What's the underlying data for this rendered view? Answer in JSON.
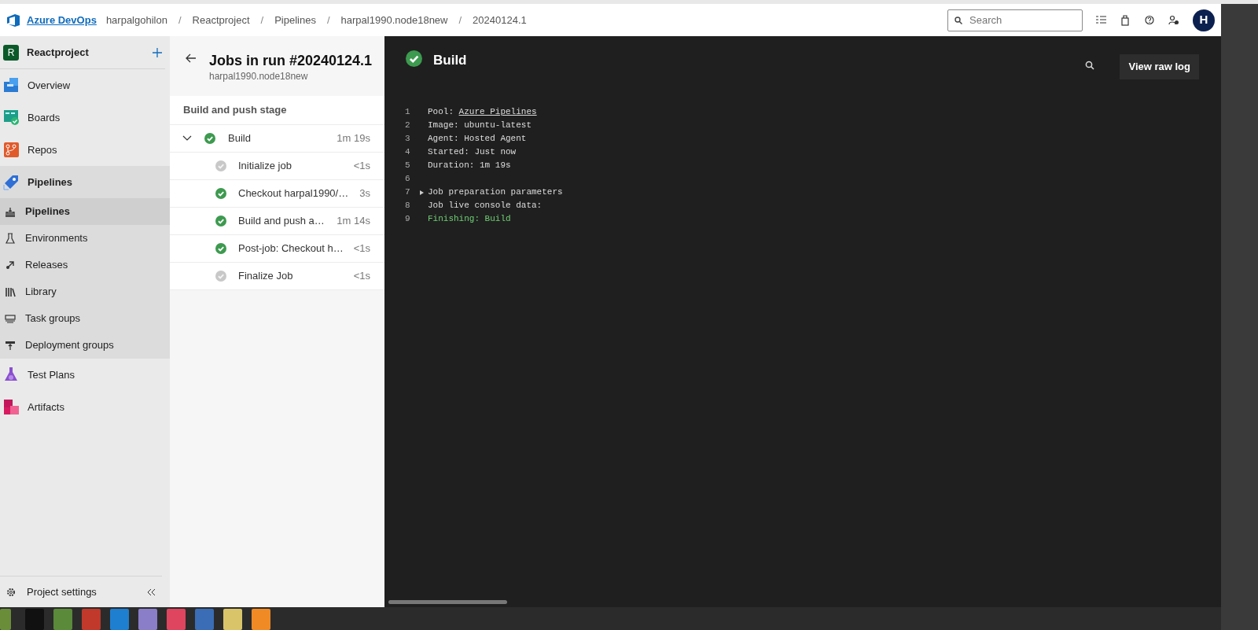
{
  "topbar": {
    "brand": "Azure DevOps",
    "breadcrumb": [
      "harpalgohilon",
      "Reactproject",
      "Pipelines",
      "harpal1990.node18new",
      "20240124.1"
    ],
    "separator": "/",
    "search": {
      "placeholder": "Search"
    },
    "avatar": "H"
  },
  "sidebar": {
    "project": {
      "initial": "R",
      "name": "Reactproject"
    },
    "items": [
      {
        "label": "Overview",
        "selected": false
      },
      {
        "label": "Boards",
        "selected": false
      },
      {
        "label": "Repos",
        "selected": false
      },
      {
        "label": "Pipelines",
        "selected": false,
        "expanded": true,
        "children": [
          {
            "label": "Pipelines",
            "selected": true
          },
          {
            "label": "Environments",
            "selected": false
          },
          {
            "label": "Releases",
            "selected": false
          },
          {
            "label": "Library",
            "selected": false
          },
          {
            "label": "Task groups",
            "selected": false
          },
          {
            "label": "Deployment groups",
            "selected": false
          }
        ]
      },
      {
        "label": "Test Plans",
        "selected": false
      },
      {
        "label": "Artifacts",
        "selected": false
      }
    ],
    "footer": "Project settings"
  },
  "jobs": {
    "title": "Jobs in run #20240124.1",
    "subtitle": "harpal1990.node18new",
    "stage": "Build and push stage",
    "job": {
      "name": "Build",
      "duration": "1m 19s",
      "succeeded": true,
      "expanded": true,
      "steps": [
        {
          "name": "Initialize job",
          "duration": "<1s",
          "succeeded": false
        },
        {
          "name": "Checkout harpal1990/…",
          "duration": "3s",
          "succeeded": true
        },
        {
          "name": "Build and push a…",
          "duration": "1m 14s",
          "succeeded": true
        },
        {
          "name": "Post-job: Checkout h…",
          "duration": "<1s",
          "succeeded": true
        },
        {
          "name": "Finalize Job",
          "duration": "<1s",
          "succeeded": false
        }
      ]
    }
  },
  "log": {
    "title": "Build",
    "succeeded": true,
    "button": "View raw log",
    "lines": [
      {
        "number": "1",
        "kind": "link",
        "text": "Pool: ",
        "link": "Azure Pipelines"
      },
      {
        "number": "2",
        "kind": "plain",
        "text": "Image: ubuntu-latest"
      },
      {
        "number": "3",
        "kind": "plain",
        "text": "Agent: Hosted Agent"
      },
      {
        "number": "4",
        "kind": "plain",
        "text": "Started: Just now"
      },
      {
        "number": "5",
        "kind": "plain",
        "text": "Duration: 1m 19s"
      },
      {
        "number": "6",
        "kind": "blank"
      },
      {
        "number": "7",
        "kind": "group",
        "text": "Job preparation parameters",
        "expanded": false
      },
      {
        "number": "8",
        "kind": "plain",
        "text": "Job live console data:"
      },
      {
        "number": "9",
        "kind": "success",
        "text": "Finishing: Build"
      }
    ]
  }
}
